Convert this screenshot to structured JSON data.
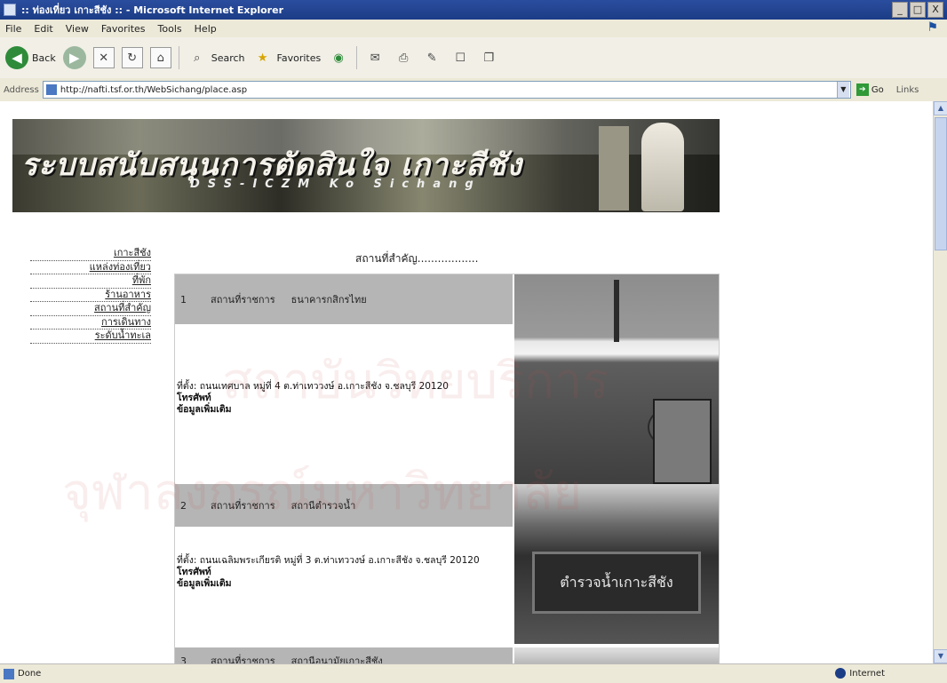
{
  "window": {
    "title": ":: ท่องเที่ยว เกาะสีชัง :: - Microsoft Internet Explorer",
    "controls": [
      "_",
      "□",
      "X"
    ]
  },
  "menubar": {
    "items": [
      "File",
      "Edit",
      "View",
      "Favorites",
      "Tools",
      "Help"
    ]
  },
  "toolbar": {
    "back_label": "Back",
    "search_label": "Search",
    "favorites_label": "Favorites"
  },
  "addressbar": {
    "label": "Address",
    "url": "http://nafti.tsf.or.th/WebSichang/place.asp",
    "go_label": "Go",
    "links_label": "Links"
  },
  "banner": {
    "title": "ระบบสนับสนุนการตัดสินใจ เกาะสีชัง",
    "subtitle": "DSS-ICZM Ko Sichang"
  },
  "nav": {
    "items": [
      "เกาะสีชัง",
      "แหล่งท่องเที่ยว",
      "ที่พัก",
      "ร้านอาหาร",
      "สถานที่สำคัญ",
      "การเดินทาง",
      "ระดับน้ำทะเล"
    ]
  },
  "section": {
    "title": "สถานที่สำคัญ.................."
  },
  "places": [
    {
      "num": "1",
      "category": "สถานที่ราชการ",
      "name": "ธนาคารกสิกรไทย",
      "address": "ที่ตั้ง: ถนนเทศบาล หมู่ที่ 4 ต.ท่าเทววงษ์ อ.เกาะสีชัง จ.ชลบุรี 20120",
      "phone_label": "โทรศัพท์",
      "more_label": "ข้อมูลเพิ่มเติม"
    },
    {
      "num": "2",
      "category": "สถานที่ราชการ",
      "name": "สถานีตำรวจน้ำ",
      "address": "ที่ตั้ง: ถนนเฉลิมพระเกียรติ หมู่ที่ 3 ต.ท่าเทววงษ์ อ.เกาะสีชัง จ.ชลบุรี 20120",
      "phone_label": "โทรศัพท์",
      "more_label": "ข้อมูลเพิ่มเติม",
      "photo_sign": "ตำรวจน้ำเกาะสีชัง"
    },
    {
      "num": "3",
      "category": "สถานที่ราชการ",
      "name": "สถานีอนามัยเกาะสีชัง"
    }
  ],
  "watermark": {
    "line1": "สถาบันวิทยบริการ",
    "line2": "จุฬาลงกรณ์มหาวิทยาลัย"
  },
  "statusbar": {
    "status": "Done",
    "zone": "Internet"
  }
}
